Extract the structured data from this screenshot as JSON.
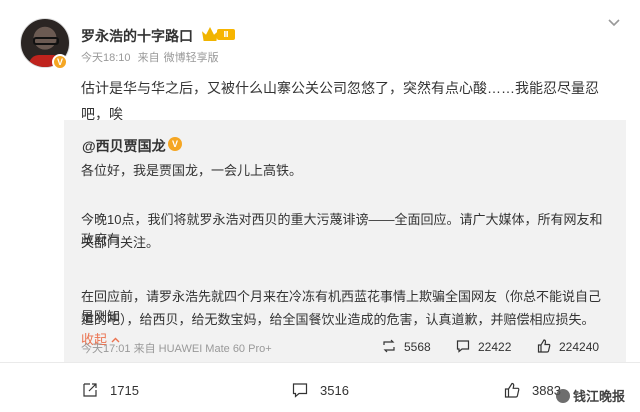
{
  "post": {
    "author": "罗永浩的十字路口",
    "level": "Ⅱ",
    "time": "今天18:10",
    "source_prefix": "来自",
    "source": "微博轻享版",
    "text": "估计是华与华之后，又被什么山寨公关公司忽悠了，突然有点心酸……我能忍尽量忍吧，唉"
  },
  "repost": {
    "author": "@西贝贾国龙",
    "line1": "各位好，我是贾国龙，一会儿上高铁。",
    "line2a": "今晚10点，我们将就罗永浩对西贝的重大污蔑诽谤——全面回应。请广大媒体，所有网友和政府有",
    "line2b": "关部门关注。",
    "line3a": "在回应前，请罗永浩先就四个月来在冷冻有机西蓝花事情上欺骗全国网友（你总不能说自己是刚知",
    "line3b": "道的吧），给西贝，给无数宝妈，给全国餐饮业造成的危害，认真道歉，并赔偿相应损失。",
    "collapse": "收起",
    "time": "今天17:01",
    "source_prefix": "来自",
    "source": "HUAWEI Mate 60 Pro+",
    "reposts": "5568",
    "comments": "22422",
    "likes": "224240"
  },
  "actions": {
    "reposts": "1715",
    "comments": "3516",
    "likes": "3883"
  },
  "watermark": "钱江晚报",
  "icons": {
    "more": "chevron-down-icon",
    "repost": "repost-icon",
    "comment": "comment-icon",
    "like": "thumb-up-icon"
  }
}
